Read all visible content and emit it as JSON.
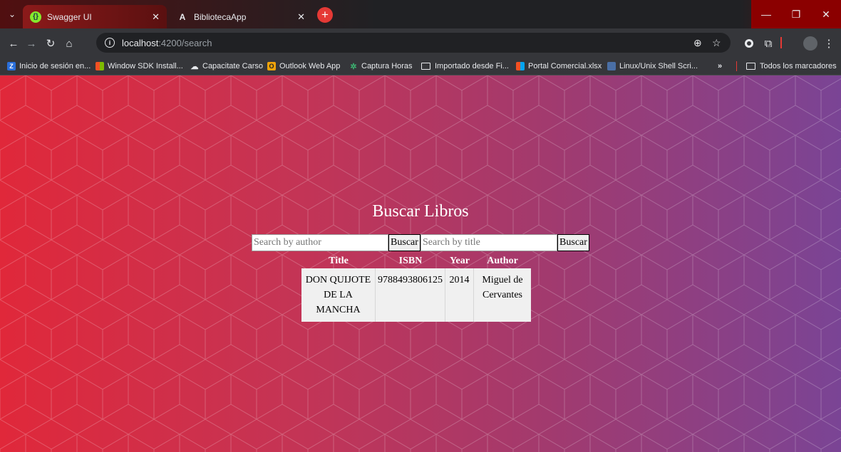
{
  "browser": {
    "tabs": [
      {
        "label": "Swagger UI",
        "active": true,
        "favicon": "swagger-icon"
      },
      {
        "label": "BibliotecaApp",
        "active": false,
        "favicon": "angular-icon"
      }
    ],
    "new_tab_label": "+",
    "url_host": "localhost",
    "url_path": ":4200/search",
    "bookmarks": [
      {
        "label": "Inicio de sesión en...",
        "icon": "z-icon"
      },
      {
        "label": "Window SDK Install...",
        "icon": "windows-icon"
      },
      {
        "label": "Capacitate Carso",
        "icon": "cloud-icon"
      },
      {
        "label": "Outlook Web App",
        "icon": "outlook-icon"
      },
      {
        "label": "Captura Horas",
        "icon": "pinwheel-icon"
      },
      {
        "label": "Importado desde Fi...",
        "icon": "folder-icon"
      },
      {
        "label": "Portal Comercial.xlsx",
        "icon": "windows-icon"
      },
      {
        "label": "Linux/Unix Shell Scri...",
        "icon": "doc-icon"
      }
    ],
    "overflow_label": "»",
    "all_bookmarks_label": "Todos los marcadores"
  },
  "page": {
    "title": "Buscar Libros",
    "author_search": {
      "placeholder": "Search by author",
      "value": "",
      "button": "Buscar"
    },
    "title_search": {
      "placeholder": "Search by title",
      "value": "",
      "button": "Buscar"
    },
    "table": {
      "headers": [
        "Title",
        "ISBN",
        "Year",
        "Author"
      ],
      "rows": [
        {
          "title": "DON QUIJOTE DE LA MANCHA",
          "isbn": "9788493806125",
          "year": "2014",
          "author": "Miguel de Cervantes"
        }
      ]
    }
  },
  "colors": {
    "gradient_start": "#e0283a",
    "gradient_end": "#7a4495",
    "tab_active": "#8b1a1a"
  }
}
